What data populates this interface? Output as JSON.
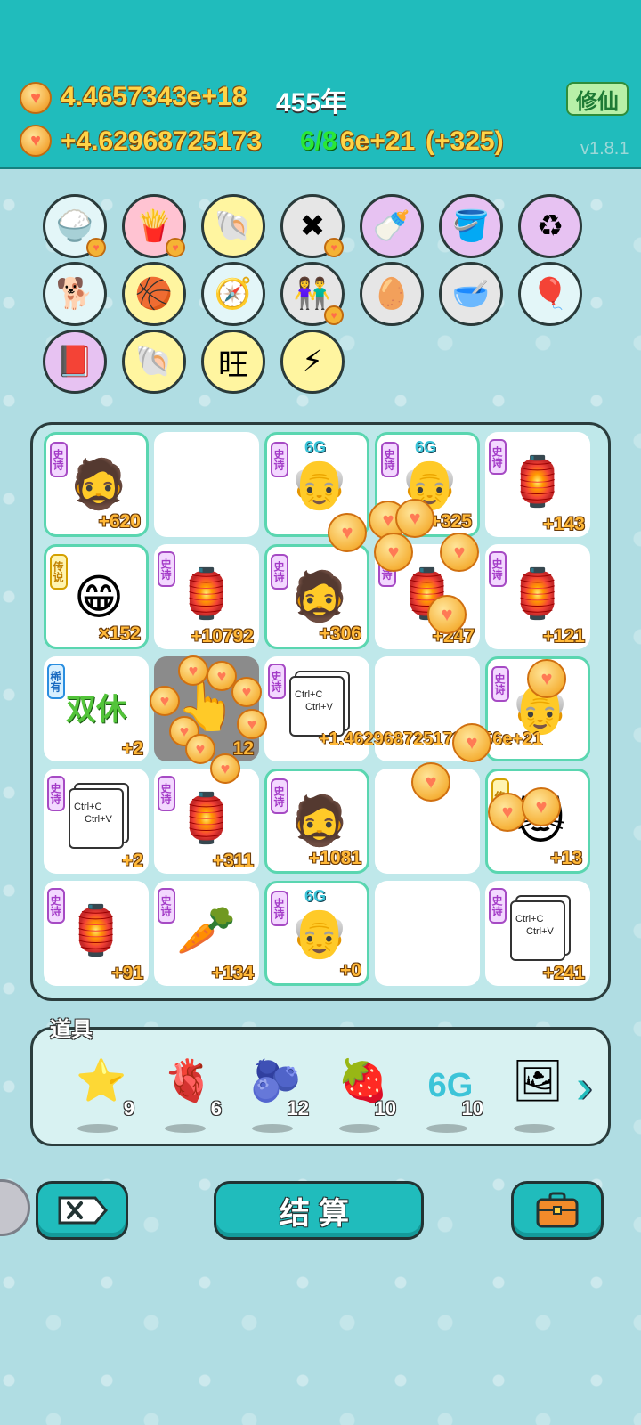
{
  "header": {
    "coins_total": "4.4657343e+18",
    "years": "455年",
    "coins_rate": "+4.62968725173",
    "coins_rate_tail": "6e+21",
    "progress": "6/8",
    "bonus": "(+325)",
    "xiuxian_label": "修仙",
    "version": "v1.8.1"
  },
  "skills": [
    {
      "name": "rice-bowl-icon",
      "bg": "#e3f6f8",
      "glyph": "🍚",
      "heart": true
    },
    {
      "name": "fries-icon",
      "bg": "#ffc3d2",
      "glyph": "🍟",
      "heart": true
    },
    {
      "name": "shell-icon",
      "bg": "#fff5a0",
      "glyph": "🐚",
      "heart": false
    },
    {
      "name": "delete-tag-icon",
      "bg": "#e6e6e6",
      "glyph": "✖",
      "heart": true
    },
    {
      "name": "breast-pump-icon",
      "bg": "#e7c2f2",
      "glyph": "🍼",
      "heart": false
    },
    {
      "name": "bucket-100-icon",
      "bg": "#e7c2f2",
      "glyph": "🪣",
      "heart": false
    },
    {
      "name": "recycle-icon",
      "bg": "#e7c2f2",
      "glyph": "♻",
      "heart": false
    },
    {
      "name": "cool-dog-icon",
      "bg": "#e3f6f8",
      "glyph": "🐕",
      "heart": false
    },
    {
      "name": "basketballs-icon",
      "bg": "#fff5a0",
      "glyph": "🏀",
      "heart": false
    },
    {
      "name": "compass-icon",
      "bg": "#e3f6f8",
      "glyph": "🧭",
      "heart": false
    },
    {
      "name": "couple-icon",
      "bg": "#e6e6e6",
      "glyph": "👫",
      "heart": true
    },
    {
      "name": "egg-tray-icon",
      "bg": "#e6e6e6",
      "glyph": "🥚",
      "heart": false
    },
    {
      "name": "pet-bowl-icon",
      "bg": "#e6e6e6",
      "glyph": "🥣",
      "heart": false
    },
    {
      "name": "air-pump-icon",
      "bg": "#e3f6f8",
      "glyph": "🎈",
      "heart": false
    },
    {
      "name": "time-magazine-icon",
      "bg": "#e7c2f2",
      "glyph": "📕",
      "heart": false
    },
    {
      "name": "shell-icon-2",
      "bg": "#fff5a0",
      "glyph": "🐚",
      "heart": false
    },
    {
      "name": "wang-wang-icon",
      "bg": "#fff5a0",
      "glyph": "旺",
      "heart": false
    },
    {
      "name": "lightning-icon",
      "bg": "#fff5a0",
      "glyph": "⚡",
      "heart": false
    }
  ],
  "cells": [
    {
      "tag": "史诗",
      "tagType": "epic",
      "pic": "bearded-man",
      "val": "+620",
      "hl": true
    },
    {
      "tag": "",
      "pic": "",
      "val": "",
      "hl": false
    },
    {
      "tag": "史诗",
      "tagType": "epic",
      "pic": "old-man",
      "val": "",
      "hl": true,
      "g6": "6G"
    },
    {
      "tag": "史诗",
      "tagType": "epic",
      "pic": "old-man",
      "val": "+325",
      "hl": true,
      "g6": "6G"
    },
    {
      "tag": "史诗",
      "tagType": "epic",
      "pic": "rabbit-house",
      "val": "+143",
      "hl": false
    },
    {
      "tag": "传说",
      "tagType": "legend",
      "pic": "grin-man",
      "val": "×152",
      "hl": true
    },
    {
      "tag": "史诗",
      "tagType": "epic",
      "pic": "rabbit-house",
      "val": "+10792",
      "hl": false
    },
    {
      "tag": "史诗",
      "tagType": "epic",
      "pic": "bearded-man",
      "val": "+306",
      "hl": true
    },
    {
      "tag": "史诗",
      "tagType": "epic",
      "pic": "rabbit-house",
      "val": "+247",
      "hl": false
    },
    {
      "tag": "史诗",
      "tagType": "epic",
      "pic": "rabbit-house",
      "val": "+121",
      "hl": false
    },
    {
      "tag": "稀有",
      "tagType": "rare",
      "pic": "shuangxiu",
      "val": "+2",
      "hl": false,
      "text": "双休"
    },
    {
      "tag": "",
      "pic": "hand",
      "val": "12",
      "hl": false,
      "dark": true
    },
    {
      "tag": "史诗",
      "tagType": "epic",
      "pic": "copy-card",
      "val": "",
      "hl": false
    },
    {
      "tag": "",
      "pic": "",
      "val": "",
      "hl": false
    },
    {
      "tag": "史诗",
      "tagType": "epic",
      "pic": "old-man",
      "val": "",
      "hl": true
    },
    {
      "tag": "史诗",
      "tagType": "epic",
      "pic": "copy-card",
      "val": "+2",
      "hl": false
    },
    {
      "tag": "史诗",
      "tagType": "epic",
      "pic": "rabbit-house",
      "val": "+311",
      "hl": false
    },
    {
      "tag": "史诗",
      "tagType": "epic",
      "pic": "bearded-man",
      "val": "+1081",
      "hl": true
    },
    {
      "tag": "",
      "pic": "",
      "val": "",
      "hl": false
    },
    {
      "tag": "传",
      "tagType": "legend",
      "pic": "cat",
      "val": "+13",
      "hl": true
    },
    {
      "tag": "史诗",
      "tagType": "epic",
      "pic": "rabbit-house",
      "val": "+91",
      "hl": false
    },
    {
      "tag": "史诗",
      "tagType": "epic",
      "pic": "carrot",
      "val": "+134",
      "hl": false
    },
    {
      "tag": "史诗",
      "tagType": "epic",
      "pic": "old-man",
      "val": "+0",
      "hl": true,
      "g6": "6G"
    },
    {
      "tag": "",
      "pic": "",
      "val": "",
      "hl": false
    },
    {
      "tag": "史诗",
      "tagType": "epic",
      "pic": "copy-card",
      "val": "+241",
      "hl": false
    }
  ],
  "copy_card_text": [
    "Ctrl+C",
    "Ctrl+V"
  ],
  "float_text": "+1.4629687251733456e+21",
  "props": {
    "title": "道具",
    "items": [
      {
        "name": "star-icon",
        "glyph": "⭐",
        "count": "9"
      },
      {
        "name": "liver-icon",
        "glyph": "🫀",
        "count": "6"
      },
      {
        "name": "blueberry-icon",
        "glyph": "🫐",
        "count": "12"
      },
      {
        "name": "lychee-icon",
        "glyph": "🍓",
        "count": "10"
      },
      {
        "name": "6g-icon",
        "glyph": "6G",
        "count": "10"
      },
      {
        "name": "portrait-frame-icon",
        "glyph": "🖼",
        "count": ""
      }
    ]
  },
  "buttons": {
    "settle_label": "结算"
  }
}
